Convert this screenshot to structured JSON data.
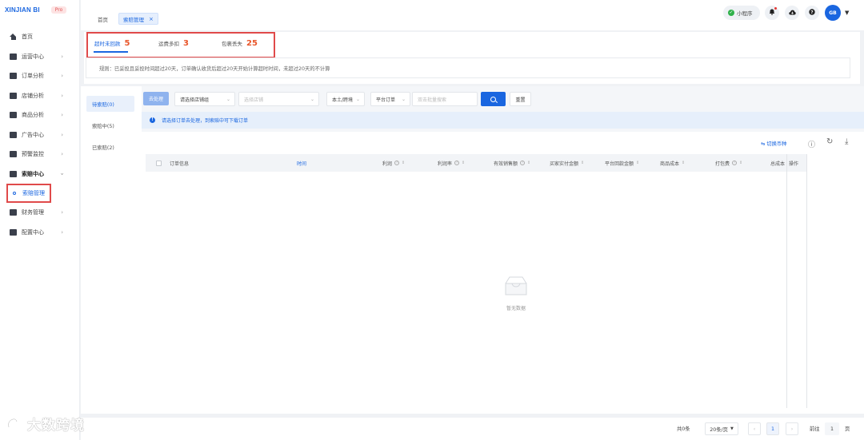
{
  "brand": {
    "logo": "XINJIAN BI",
    "badge": "Pro"
  },
  "sidebar": {
    "items": [
      {
        "label": "首页",
        "icon": "home-icon",
        "has_chevron": false
      },
      {
        "label": "运营中心",
        "icon": "monitor-icon",
        "has_chevron": true
      },
      {
        "label": "订单分析",
        "icon": "bar-chart-icon",
        "has_chevron": true
      },
      {
        "label": "店铺分析",
        "icon": "shop-icon",
        "has_chevron": true
      },
      {
        "label": "商品分析",
        "icon": "product-icon",
        "has_chevron": true
      },
      {
        "label": "广告中心",
        "icon": "ad-icon",
        "has_chevron": true
      },
      {
        "label": "预警监控",
        "icon": "warning-icon",
        "has_chevron": true
      },
      {
        "label": "索赔中心",
        "icon": "claim-icon",
        "has_chevron": true,
        "open": true
      },
      {
        "label": "财务管理",
        "icon": "finance-icon",
        "has_chevron": true
      },
      {
        "label": "配置中心",
        "icon": "settings-icon",
        "has_chevron": true
      }
    ],
    "active_sub": "索赔管理"
  },
  "tabs": {
    "home": "首页",
    "active": "索赔管理",
    "close": "×"
  },
  "topbar": {
    "mini_program": "小程序",
    "avatar": "GB"
  },
  "status_tabs": [
    {
      "label": "超时未回款",
      "count": "5",
      "active": true
    },
    {
      "label": "运费多扣",
      "count": "3",
      "active": false
    },
    {
      "label": "包裹丢失",
      "count": "25",
      "active": false
    }
  ],
  "rule_text": "规则：已妥投且妥投时间超过20天，订单确认收货后超过20天开始计算超时时间，未超过20天的不计算",
  "side_tabs": [
    {
      "label": "待索赔(0)",
      "active": true
    },
    {
      "label": "索赔中(5)",
      "active": false
    },
    {
      "label": "已索赔(2)",
      "active": false
    }
  ],
  "filters": {
    "go_button": "去处理",
    "store_group": "请选择店铺组",
    "store_placeholder": "选择店铺",
    "region": "本土/跨境",
    "platform_order": "平台订单",
    "batch_placeholder": "双击批量搜索",
    "reset": "重置"
  },
  "info_text": "请选择订单去处理，到索赔中可下载订单",
  "table": {
    "switch_currency": "切换币种",
    "columns": [
      {
        "label": "订单信息",
        "help": false,
        "sort": false
      },
      {
        "label": "时间",
        "help": false,
        "sort": false,
        "link": true
      },
      {
        "label": "利润",
        "help": true,
        "sort": true
      },
      {
        "label": "利润率",
        "help": true,
        "sort": true
      },
      {
        "label": "有效销售额",
        "help": true,
        "sort": true
      },
      {
        "label": "买家实付金额",
        "help": false,
        "sort": true
      },
      {
        "label": "平台回款金额",
        "help": false,
        "sort": true
      },
      {
        "label": "商品成本",
        "help": false,
        "sort": true
      },
      {
        "label": "打包费",
        "help": true,
        "sort": true
      },
      {
        "label": "总成本",
        "help": false,
        "sort": false
      }
    ],
    "op_column": "操作",
    "empty_text": "暂无数据"
  },
  "pager": {
    "total": "共0条",
    "page_size": "20条/页",
    "current_page": "1",
    "goto_label": "前往",
    "goto_value": "1",
    "page_unit": "页"
  },
  "watermark": "大数跨境",
  "colors": {
    "primary": "#1a66e0",
    "highlight_box": "#e04a4a",
    "count": "#e8562a"
  }
}
